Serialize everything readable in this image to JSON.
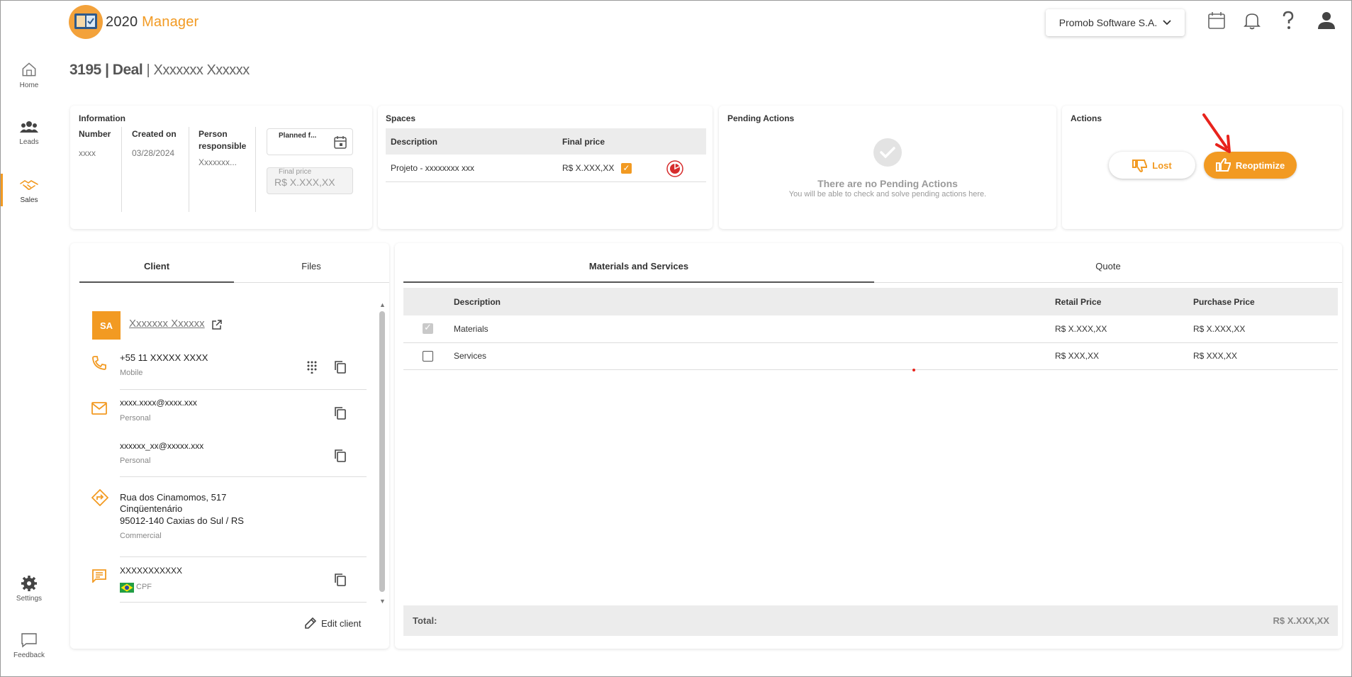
{
  "app": {
    "logo_text_main": "2020",
    "logo_text_suffix": "Manager"
  },
  "header": {
    "company": "Promob Software S.A."
  },
  "sidebar": {
    "items": [
      {
        "label": "Home",
        "icon": "home-icon"
      },
      {
        "label": "Leads",
        "icon": "people-icon"
      },
      {
        "label": "Sales",
        "icon": "handshake-icon"
      }
    ],
    "bottom": [
      {
        "label": "Settings",
        "icon": "gear-icon"
      },
      {
        "label": "Feedback",
        "icon": "chat-icon"
      }
    ]
  },
  "title": {
    "deal_id": "3195",
    "sep1": "|",
    "deal_label": "Deal",
    "sep2": "|",
    "client": "Xxxxxxx Xxxxxx"
  },
  "information": {
    "title": "Information",
    "number_label": "Number",
    "number_value": "xxxx",
    "created_label": "Created on",
    "created_value": "03/28/2024",
    "person_label": "Person responsible",
    "person_value": "Xxxxxxx...",
    "planned_label": "Planned f...",
    "final_price_label": "Final price",
    "final_price_value": "R$ X.XXX,XX"
  },
  "spaces": {
    "title": "Spaces",
    "col_description": "Description",
    "col_final_price": "Final price",
    "rows": [
      {
        "description": "Projeto - xxxxxxxx xxx",
        "final_price": "R$ X.XXX,XX"
      }
    ]
  },
  "pending": {
    "title": "Pending Actions",
    "empty_title": "There are no Pending Actions",
    "empty_sub": "You will be able to check and solve pending actions here."
  },
  "actions": {
    "title": "Actions",
    "lost": "Lost",
    "reoptimize": "Reoptimize"
  },
  "client_panel": {
    "tab_client": "Client",
    "tab_files": "Files",
    "avatar": "SA",
    "name": "Xxxxxxx Xxxxxx",
    "phone": "+55 11 XXXXX XXXX",
    "phone_type": "Mobile",
    "email1": "xxxx.xxxx@xxxx.xxx",
    "email1_type": "Personal",
    "email2": "xxxxxx_xx@xxxxx.xxx",
    "email2_type": "Personal",
    "address_line1": "Rua dos Cinamomos, 517",
    "address_line2": "Cinqüentenário",
    "address_line3": "95012-140 Caxias do Sul / RS",
    "address_type": "Commercial",
    "document": "XXXXXXXXXXX",
    "document_type": "CPF",
    "edit": "Edit client"
  },
  "materials_panel": {
    "tab_materials": "Materials and Services",
    "tab_quote": "Quote",
    "col_description": "Description",
    "col_retail": "Retail Price",
    "col_purchase": "Purchase Price",
    "rows": [
      {
        "description": "Materials",
        "retail": "R$ X.XXX,XX",
        "purchase": "R$ X.XXX,XX",
        "checked": true
      },
      {
        "description": "Services",
        "retail": "R$ XXX,XX",
        "purchase": "R$ XXX,XX",
        "checked": false
      }
    ],
    "total_label": "Total:",
    "total_value": "R$ X.XXX,XX"
  },
  "colors": {
    "accent": "#f29a22",
    "annotation_arrow": "#e8231c"
  }
}
